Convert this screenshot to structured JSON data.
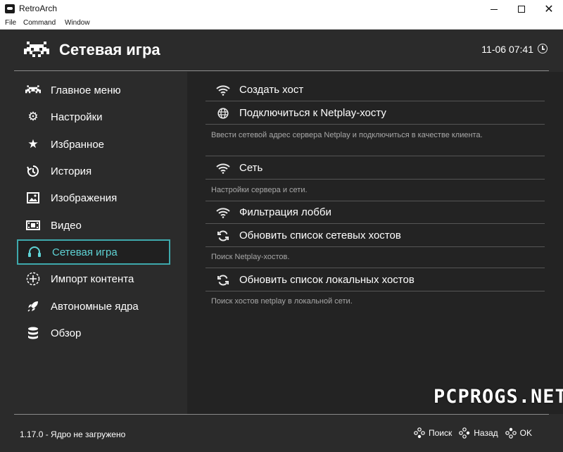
{
  "window": {
    "title": "RetroArch",
    "controls": {
      "minimize": "",
      "maximize": "",
      "close": "✕"
    }
  },
  "menubar": {
    "items": [
      "File",
      "Command",
      "Window"
    ]
  },
  "header": {
    "title": "Сетевая игра",
    "clock": "11-06 07:41",
    "logo_icon": "retroarch-invader-icon"
  },
  "sidebar": {
    "items": [
      {
        "label": "Главное меню",
        "icon": "invader-icon",
        "active": false
      },
      {
        "label": "Настройки",
        "icon": "gear-icon",
        "active": false
      },
      {
        "label": "Избранное",
        "icon": "star-icon",
        "active": false
      },
      {
        "label": "История",
        "icon": "history-icon",
        "active": false
      },
      {
        "label": "Изображения",
        "icon": "image-icon",
        "active": false
      },
      {
        "label": "Видео",
        "icon": "film-icon",
        "active": false
      },
      {
        "label": "Сетевая игра",
        "icon": "headset-icon",
        "active": true
      },
      {
        "label": "Импорт контента",
        "icon": "plus-circle-icon",
        "active": false
      },
      {
        "label": "Автономные ядра",
        "icon": "rocket-icon",
        "active": false
      },
      {
        "label": "Обзор",
        "icon": "database-icon",
        "active": false
      }
    ]
  },
  "content": {
    "items": [
      {
        "label": "Создать хост",
        "icon": "wifi-icon",
        "sublabel": ""
      },
      {
        "label": "Подключиться к Netplay-хосту",
        "icon": "globe-icon",
        "sublabel": "Ввести сетевой адрес сервера Netplay и подключиться в качестве клиента."
      },
      {
        "label": "Сеть",
        "icon": "wifi-icon",
        "sublabel": "Настройки сервера и сети."
      },
      {
        "label": "Фильтрация лобби",
        "icon": "wifi-icon",
        "sublabel": ""
      },
      {
        "label": "Обновить список сетевых хостов",
        "icon": "refresh-icon",
        "sublabel": "Поиск Netplay-хостов."
      },
      {
        "label": "Обновить список локальных хостов",
        "icon": "refresh-icon",
        "sublabel": "Поиск хостов netplay в локальной сети."
      }
    ]
  },
  "footer": {
    "status": "1.17.0 - Ядро не загружено",
    "actions": [
      {
        "label": "Поиск",
        "icon": "gamepad-button-icon"
      },
      {
        "label": "Назад",
        "icon": "gamepad-button-icon"
      },
      {
        "label": "OK",
        "icon": "gamepad-button-icon"
      }
    ]
  },
  "watermark": "PCPROGS.NET",
  "colors": {
    "accent": "#5fd3d5",
    "accent_border": "#3ea9ac",
    "background": "#2b2b2b",
    "content_background": "#232323"
  }
}
